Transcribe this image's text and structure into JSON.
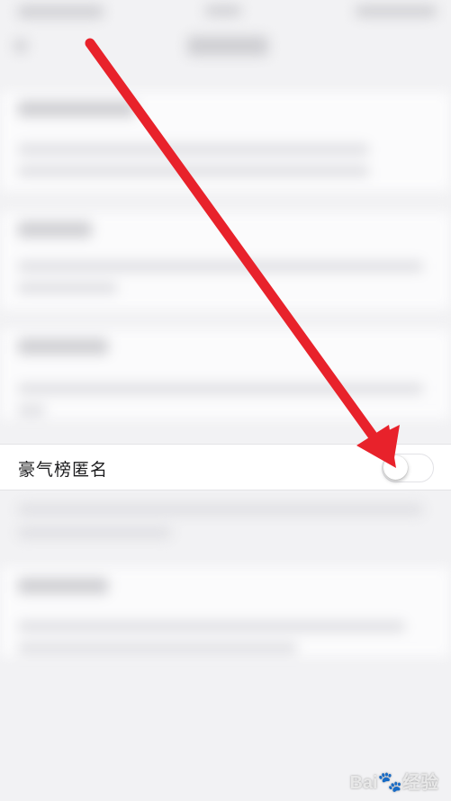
{
  "row": {
    "label": "豪气榜匿名",
    "toggle_on": false
  },
  "watermark": {
    "text": "Bai",
    "paw": "🐾",
    "suffix": "经验"
  },
  "colors": {
    "arrow": "#e8222b",
    "row_bg": "#ffffff",
    "page_bg": "#f2f2f4"
  }
}
